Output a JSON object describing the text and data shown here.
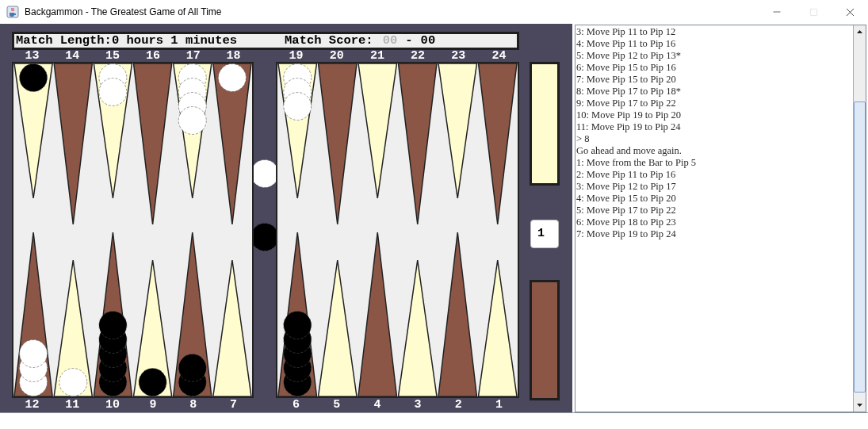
{
  "window": {
    "title": "Backgammon - The Greatest Game of All Time"
  },
  "header": {
    "match_length": "Match Length:0 hours 1 minutes",
    "score_label": "Match Score:",
    "score_first": "00",
    "score_separator": "-",
    "score_second": "00"
  },
  "board": {
    "top_left": [
      {
        "label": "13",
        "color": "#fffdd0",
        "checkers": [
          {
            "color": "#000000"
          }
        ]
      },
      {
        "label": "14",
        "color": "#8b5646"
      },
      {
        "label": "15",
        "color": "#fffdd0",
        "checkers": [
          {
            "color": "#ffffff"
          },
          {
            "color": "#ffffff"
          }
        ]
      },
      {
        "label": "16",
        "color": "#8b5646"
      },
      {
        "label": "17",
        "color": "#fffdd0",
        "checkers": [
          {
            "color": "#ffffff"
          },
          {
            "color": "#ffffff"
          },
          {
            "color": "#ffffff"
          },
          {
            "color": "#ffffff"
          }
        ]
      },
      {
        "label": "18",
        "color": "#8b5646",
        "checkers": [
          {
            "color": "#ffffff"
          }
        ]
      }
    ],
    "top_right": [
      {
        "label": "19",
        "color": "#fffdd0",
        "checkers": [
          {
            "color": "#ffffff"
          },
          {
            "color": "#ffffff"
          },
          {
            "color": "#ffffff"
          }
        ]
      },
      {
        "label": "20",
        "color": "#8b5646"
      },
      {
        "label": "21",
        "color": "#fffdd0"
      },
      {
        "label": "22",
        "color": "#8b5646"
      },
      {
        "label": "23",
        "color": "#fffdd0"
      },
      {
        "label": "24",
        "color": "#8b5646"
      }
    ],
    "bottom_left": [
      {
        "label": "12",
        "color": "#8b5646",
        "checkers": [
          {
            "color": "#ffffff"
          },
          {
            "color": "#ffffff"
          },
          {
            "color": "#ffffff"
          }
        ]
      },
      {
        "label": "11",
        "color": "#fffdd0",
        "checkers": [
          {
            "color": "#ffffff"
          }
        ]
      },
      {
        "label": "10",
        "color": "#8b5646",
        "checkers": [
          {
            "color": "#000000"
          },
          {
            "color": "#000000"
          },
          {
            "color": "#000000"
          },
          {
            "color": "#000000"
          },
          {
            "color": "#000000"
          }
        ]
      },
      {
        "label": "9",
        "color": "#fffdd0",
        "checkers": [
          {
            "color": "#000000"
          }
        ]
      },
      {
        "label": "8",
        "color": "#8b5646",
        "checkers": [
          {
            "color": "#000000"
          },
          {
            "color": "#000000"
          }
        ]
      },
      {
        "label": "7",
        "color": "#fffdd0"
      }
    ],
    "bottom_right": [
      {
        "label": "6",
        "color": "#8b5646",
        "checkers": [
          {
            "color": "#000000"
          },
          {
            "color": "#000000"
          },
          {
            "color": "#000000"
          },
          {
            "color": "#000000"
          },
          {
            "color": "#000000"
          }
        ]
      },
      {
        "label": "5",
        "color": "#fffdd0"
      },
      {
        "label": "4",
        "color": "#8b5646"
      },
      {
        "label": "3",
        "color": "#fffdd0"
      },
      {
        "label": "2",
        "color": "#8b5646"
      },
      {
        "label": "1",
        "color": "#fffdd0"
      }
    ],
    "bar": {
      "top": [
        {
          "color": "#ffffff"
        }
      ],
      "bottom": [
        {
          "color": "#000000"
        }
      ]
    }
  },
  "trays": [
    {
      "color": "#fffdd0"
    },
    {
      "color": "#8b5646"
    }
  ],
  "cube": {
    "value": "1"
  },
  "log": {
    "lines": [
      "3: Move Pip 11 to Pip 12",
      "4: Move Pip 11 to Pip 16",
      "5: Move Pip 12 to Pip 13*",
      "6: Move Pip 15 to Pip 16",
      "7: Move Pip 15 to Pip 20",
      "8: Move Pip 17 to Pip 18*",
      "9: Move Pip 17 to Pip 22",
      "10: Move Pip 19 to Pip 20",
      "11: Move Pip 19 to Pip 24",
      "> 8",
      "Go ahead and move again.",
      "1: Move from the Bar to Pip 5",
      "2: Move Pip 11 to Pip 16",
      "3: Move Pip 12 to Pip 17",
      "4: Move Pip 15 to Pip 20",
      "5: Move Pip 17 to Pip 22",
      "6: Move Pip 18 to Pip 23",
      "7: Move Pip 19 to Pip 24"
    ]
  }
}
